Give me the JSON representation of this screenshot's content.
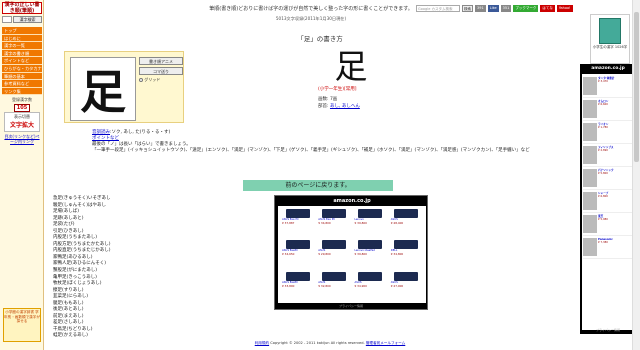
{
  "sidebar": {
    "logo": "漢字の正しい書き順(筆順)",
    "search_button": "漢字検索",
    "items": [
      {
        "label": "トップ"
      },
      {
        "label": "はじめに"
      },
      {
        "label": "漢字の一覧"
      },
      {
        "label": "漢字の書き順"
      },
      {
        "label": "ポイントなど"
      },
      {
        "label": "ひらがな・カタカナ"
      },
      {
        "label": "筆順の基本"
      },
      {
        "label": "参考資料など"
      },
      {
        "label": "リンク集"
      }
    ],
    "count_label": "登録漢字数",
    "count_value": "105",
    "enlarge_label": "表示切替",
    "enlarge_title": "文字拡大",
    "side_link": "目次(リンクなど)ページ内リンク",
    "left_ad": "小学館の漢字辞書 学年別・画数順で漢字が探せる"
  },
  "header": {
    "banner": "筆順(書き順)どおりに書けば字の運びが自然で美しく整った字の形に書くことができます。",
    "banner_sub": "5013文字収録(2011年1月30日現在)",
    "google_placeholder": "Google カスタム検索",
    "search_button": "検索",
    "sns": [
      "391",
      "Like",
      "351",
      "ブックマーク",
      "はてな",
      "bookmark",
      "Yahoo!"
    ]
  },
  "content": {
    "title": "「足」の書き方",
    "character": "足",
    "buttons": [
      "書き順アニメ",
      "コマ送り"
    ],
    "grid_label": "グリッド",
    "grade": "(小学一年生)[常用]",
    "stroke_count": "画数: 7画",
    "radical_label": "部首:",
    "radical_value": "あし, あしへん",
    "readings_label": "音訓読み",
    "readings_text": ":ソク, あし, た(りる・る・す)",
    "point_label": "ポイントなど",
    "point_text": "最後の「ノ」は長い「はらい」で書きましょう。",
    "point_detail": "「一筆手一段足」(イッキョシュイットウソク)、「遠足」(エンソク)、「満足」(マンゾク)、「下足」(ゲソク)、「義手足」(ギシュゾク)、「補足」(ホソク)、「満足」(マンゾク)、「満足感」(マンゾクカン)、「足手纏い」など",
    "back_button": "前のページに戻ります。",
    "words": [
      "急足(きゅうそく)いそぎあし",
      "駿足(しゅんそく)はやあし",
      "足場(あしば)",
      "足跡(あしあと)",
      "足袋(たび)",
      "引足(ひきあし)",
      "内股足(うちまたあし)",
      "内股方足(うちまたかたあし)",
      "内股直足(うちまたじかあし)",
      "家鴨足(あひるあし)",
      "家鴨人足(あひるにんそく)",
      "蟹股足(がにまたあし)",
      "亀甲足(きっこうあし)",
      "牧杖足(ぼくじょうあし)",
      "擦足(すりあし)",
      "韮菜足(にらあし)",
      "腿足(ももあし)",
      "後足(あとあし)",
      "前足(まえあし)",
      "差足(さしあし)",
      "千鳥足(ちどりあし)",
      "蛙足(かえるあし)"
    ]
  },
  "amazon": {
    "logo": "amazon.co.jp",
    "products": [
      {
        "name": "ASUS Eee PC",
        "price": "¥ 37,887"
      },
      {
        "name": "ASUS Eee PC",
        "price": "¥ 34,800"
      },
      {
        "name": "Lenovo",
        "price": "¥ 39,800"
      },
      {
        "name": "ASUS",
        "price": "¥ 48,400"
      },
      {
        "name": "ASUS EeePC",
        "price": "¥ 34,650"
      },
      {
        "name": "ASUS",
        "price": "¥ 29,800"
      },
      {
        "name": "Lenovo IdeaPad",
        "price": "¥ 39,800"
      },
      {
        "name": "DELL",
        "price": "¥ 34,800"
      },
      {
        "name": "ASUS EeePC",
        "price": "¥ 33,800"
      },
      {
        "name": "ASUS",
        "price": "¥ 32,800"
      },
      {
        "name": "ASUS",
        "price": "¥ 34,900"
      },
      {
        "name": "ASUS",
        "price": "¥ 47,000"
      }
    ],
    "footer": "プライバシー情報"
  },
  "right": {
    "ad_label": "小学生の漢字 1026字",
    "amazon_logo": "amazon.co.jp",
    "items": [
      {
        "name": "タニタ 体重計",
        "price": "¥ 3,470"
      },
      {
        "name": "オムロン",
        "price": "¥ 6,600"
      },
      {
        "name": "ライオン",
        "price": "¥ 1,780"
      },
      {
        "name": "フィリップス",
        "price": "¥ 2,890"
      },
      {
        "name": "パナソニック",
        "price": "¥ 5,800"
      },
      {
        "name": "シャープ",
        "price": "¥ 6,800"
      },
      {
        "name": "東芝",
        "price": "¥ 5,980"
      },
      {
        "name": "Panasonic",
        "price": "¥ 7,380"
      }
    ],
    "footer": "プライバシー情報"
  },
  "footer": {
    "privacy": "利用規約",
    "copyright": "Copyright © 2002 - 2011 kakijun All rights reserved.",
    "contact": "管理者宛メールフォーム"
  }
}
